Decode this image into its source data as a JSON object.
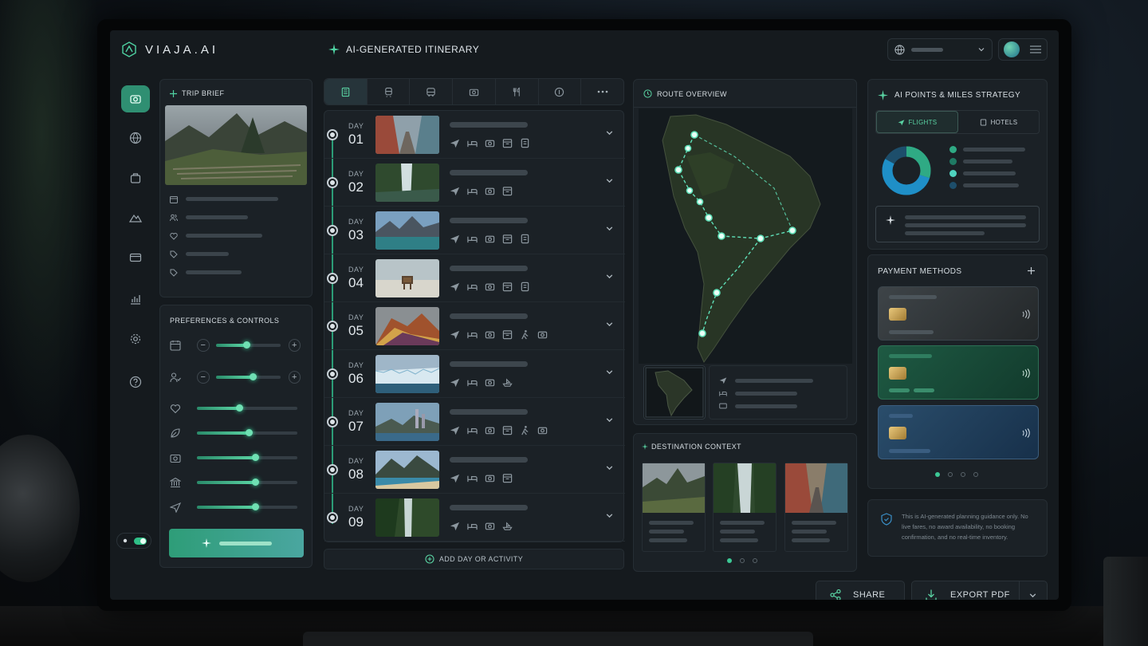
{
  "app": {
    "brand": "VIAJA.AI"
  },
  "header": {
    "title": "AI-GENERATED ITINERARY"
  },
  "rail": {
    "items": [
      "camera-icon",
      "globe-icon",
      "bag-icon",
      "mountain-icon",
      "card-icon",
      "chart-icon",
      "gear-icon",
      "help-icon"
    ],
    "active": "camera-icon"
  },
  "trip_brief": {
    "title": "TRIP BRIEF"
  },
  "preferences": {
    "title": "PREFERENCES & CONTROLS"
  },
  "itinerary": {
    "tabs": [
      "hotel-icon",
      "train-icon",
      "bus-icon",
      "camera-icon",
      "dining-icon",
      "coin-icon",
      "more-icon"
    ],
    "day_label": "DAY",
    "days": [
      {
        "num": "01",
        "icons": [
          "plane-icon",
          "bed-icon",
          "camera-icon",
          "calendar-icon",
          "ticket-icon"
        ]
      },
      {
        "num": "02",
        "icons": [
          "plane-icon",
          "bed-icon",
          "camera-icon",
          "calendar-icon"
        ]
      },
      {
        "num": "03",
        "icons": [
          "plane-icon",
          "bed-icon",
          "camera-icon",
          "calendar-icon",
          "ticket-icon"
        ]
      },
      {
        "num": "04",
        "icons": [
          "plane-icon",
          "bed-icon",
          "camera-icon",
          "calendar-icon",
          "ticket-icon"
        ]
      },
      {
        "num": "05",
        "icons": [
          "plane-icon",
          "bed-icon",
          "camera-icon",
          "calendar-icon",
          "hike-icon",
          "camera-icon"
        ]
      },
      {
        "num": "06",
        "icons": [
          "plane-icon",
          "bed-icon",
          "camera-icon",
          "boat-icon"
        ]
      },
      {
        "num": "07",
        "icons": [
          "plane-icon",
          "bed-icon",
          "camera-icon",
          "calendar-icon",
          "hike-icon",
          "camera-icon"
        ]
      },
      {
        "num": "08",
        "icons": [
          "plane-icon",
          "bed-icon",
          "camera-icon",
          "calendar-icon"
        ]
      },
      {
        "num": "09",
        "icons": [
          "plane-icon",
          "bed-icon",
          "camera-icon",
          "boat-icon"
        ]
      }
    ],
    "add_label": "ADD DAY OR ACTIVITY"
  },
  "route": {
    "title": "ROUTE OVERVIEW"
  },
  "destination": {
    "title": "DESTINATION CONTEXT"
  },
  "points": {
    "title": "AI POINTS & MILES STRATEGY",
    "tabs": [
      "FLIGHTS",
      "HOTELS"
    ],
    "donut_colors": [
      "#1f8fc7",
      "#2faa84",
      "#1d4e6b"
    ]
  },
  "payment": {
    "title": "PAYMENT METHODS"
  },
  "disclaimer": {
    "text": "This is AI-generated planning guidance only. No live fares, no award availability, no booking confirmation, and no real-time inventory."
  },
  "actions": {
    "share": "SHARE",
    "export": "EXPORT PDF"
  },
  "colors": {
    "accent": "#2f9d78",
    "route": "#5fe0b8"
  }
}
